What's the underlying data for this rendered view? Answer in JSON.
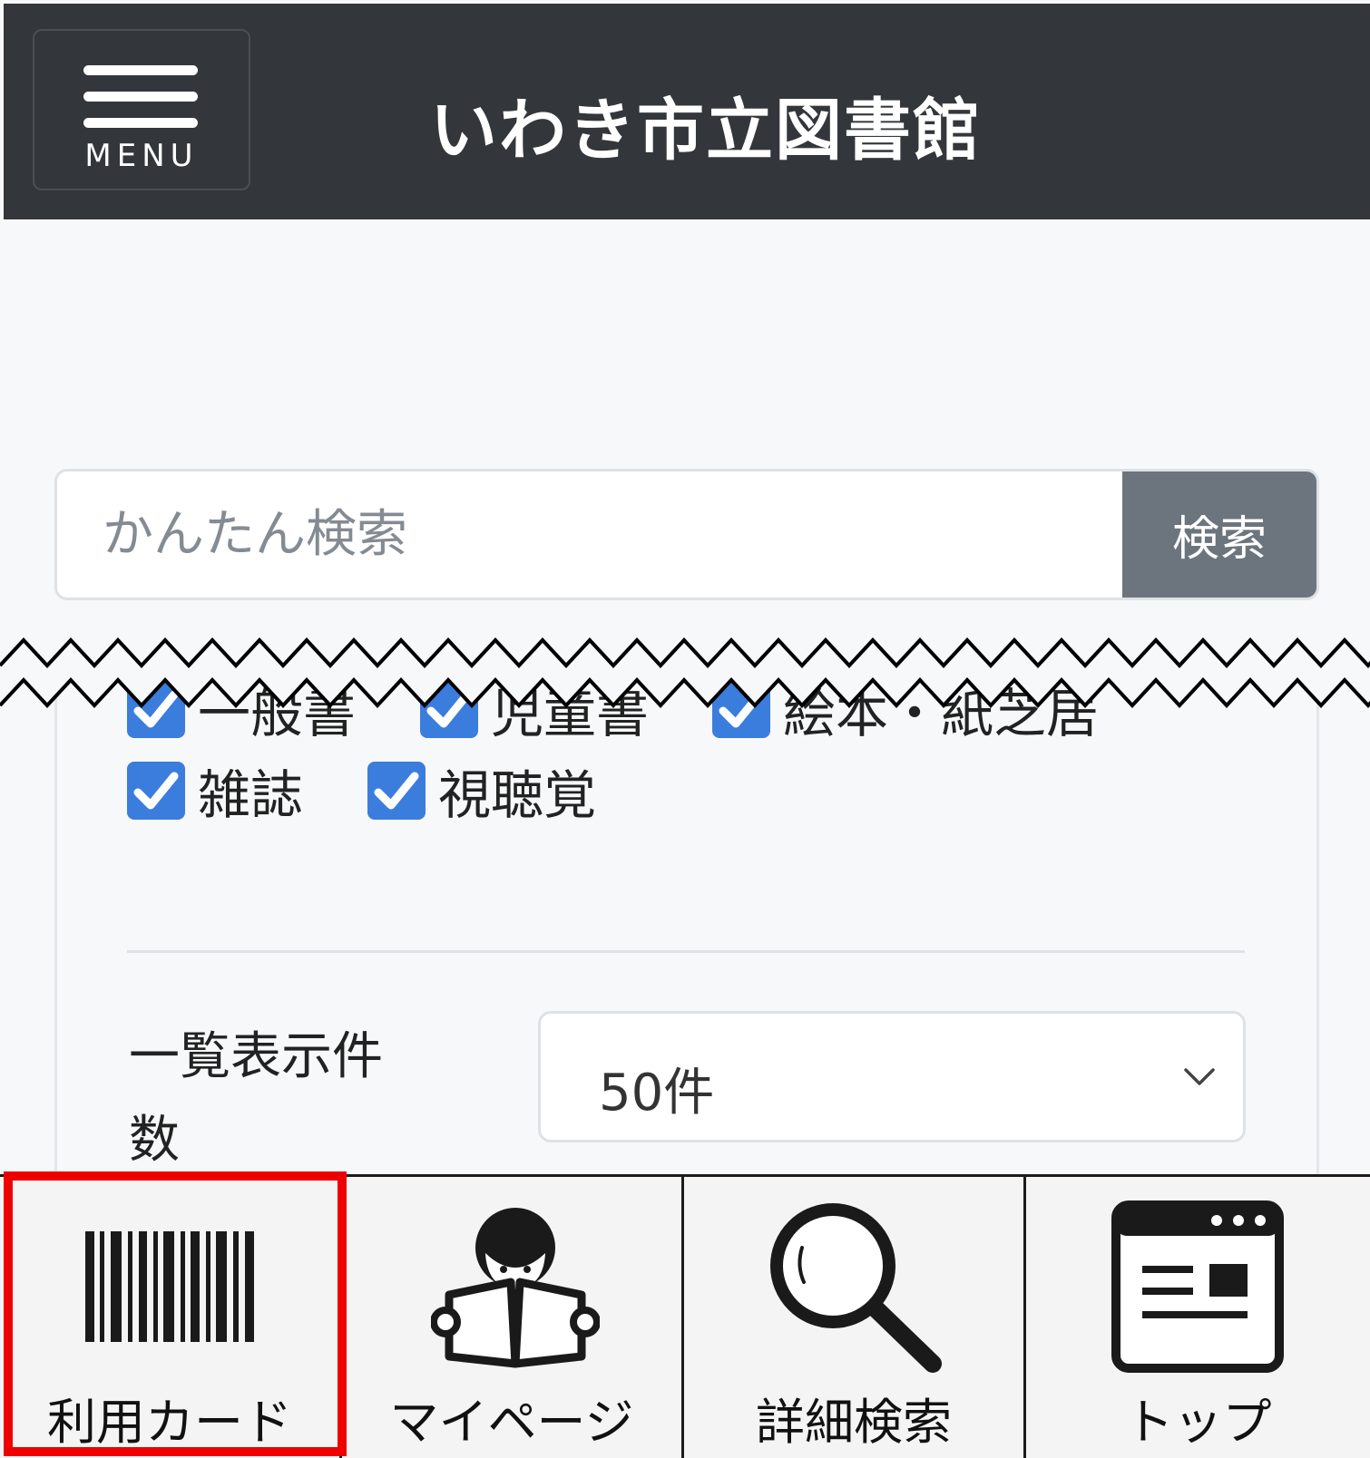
{
  "header": {
    "menu_label": "MENU",
    "title": "いわき市立図書館"
  },
  "search": {
    "placeholder": "かんたん検索",
    "button_label": "検索"
  },
  "categories": {
    "partial_row": [
      "一般書",
      "児童書",
      "絵本・紙芝居"
    ],
    "items": [
      {
        "label": "雑誌",
        "checked": true
      },
      {
        "label": "視聴覚",
        "checked": true
      }
    ]
  },
  "display_count": {
    "label": "一覧表示件数",
    "value": "50件"
  },
  "bottom_nav": [
    {
      "label": "利用カード",
      "icon": "barcode-icon",
      "highlighted": true
    },
    {
      "label": "マイページ",
      "icon": "reader-icon",
      "highlighted": false
    },
    {
      "label": "詳細検索",
      "icon": "magnifier-icon",
      "highlighted": false
    },
    {
      "label": "トップ",
      "icon": "browser-window-icon",
      "highlighted": false
    }
  ],
  "colors": {
    "header_bg": "#33373c",
    "checkbox": "#3b7ddd",
    "search_button": "#6c757d",
    "highlight": "#ee0000"
  }
}
